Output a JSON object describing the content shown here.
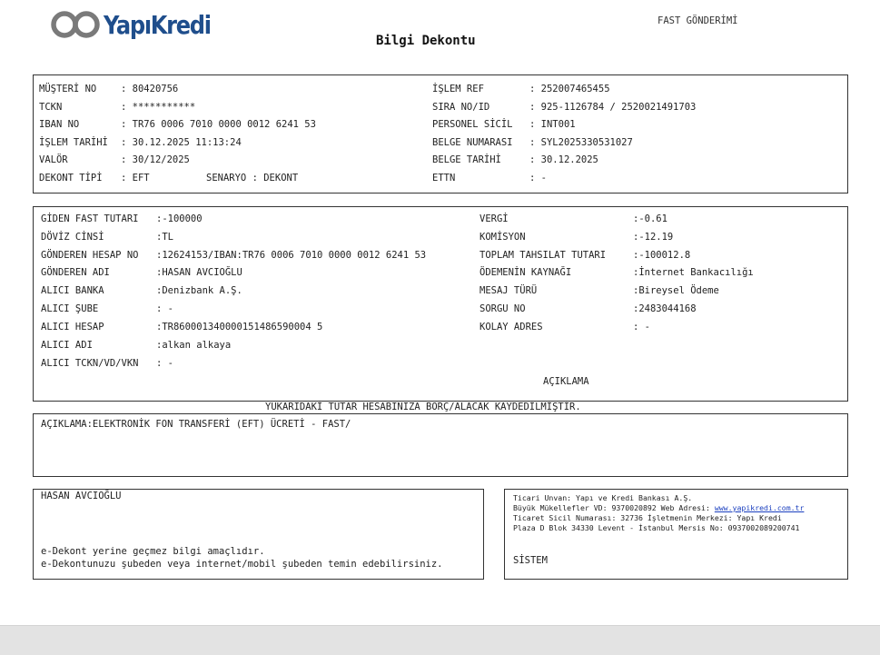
{
  "header": {
    "brand": "YapıKredi",
    "title": "Bilgi Dekontu",
    "top_right": "FAST GÖNDERİMİ"
  },
  "info": {
    "musteri_no_label": "MÜŞTERİ NO",
    "musteri_no": "80420756",
    "tckn_label": "TCKN",
    "tckn": "***********",
    "iban_label": "IBAN NO",
    "iban": "TR76 0006 7010 0000 0012 6241 53",
    "islem_tarihi_label": "İŞLEM TARİHİ",
    "islem_tarihi": "30.12.2025 11:13:24",
    "valor_label": "VALÖR",
    "valor": "30/12/2025",
    "dekont_tipi_label": "DEKONT TİPİ",
    "dekont_tipi": "EFT",
    "senaryo_label": "SENARYO",
    "senaryo": "DEKONT",
    "islem_ref_label": "İŞLEM REF",
    "islem_ref": "252007465455",
    "sira_no_label": "SIRA NO/ID",
    "sira_no": "925-1126784 / 2520021491703",
    "personel_sicil_label": "PERSONEL SİCİL",
    "personel_sicil": "INT001",
    "belge_numarasi_label": "BELGE NUMARASI",
    "belge_numarasi": "SYL2025330531027",
    "belge_tarihi_label": "BELGE TARİHİ",
    "belge_tarihi": "30.12.2025",
    "ettn_label": "ETTN",
    "ettn": "-"
  },
  "transfer": {
    "giden_tutar_label": "GİDEN FAST TUTARI",
    "giden_tutar": "-100000",
    "doviz_label": "DÖVİZ CİNSİ",
    "doviz": "TL",
    "gonderen_hesap_label": "GÖNDEREN HESAP NO",
    "gonderen_hesap": "12624153/IBAN:TR76 0006 7010 0000 0012 6241 53",
    "gonderen_adi_label": "GÖNDEREN ADI",
    "gonderen_adi": "HASAN AVCIOĞLU",
    "alici_banka_label": "ALICI BANKA",
    "alici_banka": "Denizbank A.Ş.",
    "alici_sube_label": "ALICI ŞUBE",
    "alici_sube": " -",
    "alici_hesap_label": "ALICI HESAP",
    "alici_hesap": "TR860001340000151486590004 5",
    "alici_adi_label": "ALICI ADI",
    "alici_adi": "alkan alkaya",
    "alici_tckn_label": "ALICI TCKN/VD/VKN",
    "alici_tckn": " -",
    "vergi_label": "VERGİ",
    "vergi": "-0.61",
    "komisyon_label": "KOMİSYON",
    "komisyon": "-12.19",
    "toplam_label": "TOPLAM TAHSILAT TUTARI",
    "toplam": "-100012.8",
    "odeme_kaynagi_label": "ÖDEMENİN KAYNAĞI",
    "odeme_kaynagi": "İnternet Bankacılığı",
    "mesaj_turu_label": "MESAJ TÜRÜ",
    "mesaj_turu": "Bireysel Ödeme",
    "sorgu_no_label": "SORGU NO",
    "sorgu_no": "2483044168",
    "kolay_adres_label": "KOLAY ADRES",
    "kolay_adres": " -",
    "aciklama_heading": "AÇIKLAMA"
  },
  "notice": "YUKARIDAKİ TUTAR HESABINIZA BORÇ/ALACAK KAYDEDİLMİŞTİR.",
  "description": "AÇIKLAMA:ELEKTRONİK FON TRANSFERİ (EFT) ÜCRETİ - FAST/",
  "customer_box": {
    "name": "HASAN AVCIOĞLU",
    "note1": "e-Dekont yerine geçmez bilgi amaçlıdır.",
    "note2": "e-Dekontunuzu şubeden veya internet/mobil şubeden temin edebilirsiniz."
  },
  "bank_box": {
    "line1": "Ticari Unvan: Yapı ve Kredi Bankası A.Ş.",
    "line2_prefix": "Büyük Mükellefler VD: 9370020892 Web Adresi: ",
    "web": "www.yapikredi.com.tr",
    "line3": "Ticaret Sicil Numarası: 32736 İşletmenin Merkezi: Yapı Kredi",
    "line4": "Plaza D Blok 34330 Levent - İstanbul Mersis No: 0937002089200741",
    "sistem": "SİSTEM"
  },
  "colors": {
    "brand_blue": "#1f4e8c",
    "logo_gray": "#7a7a7a",
    "link": "#1a3fbf"
  }
}
